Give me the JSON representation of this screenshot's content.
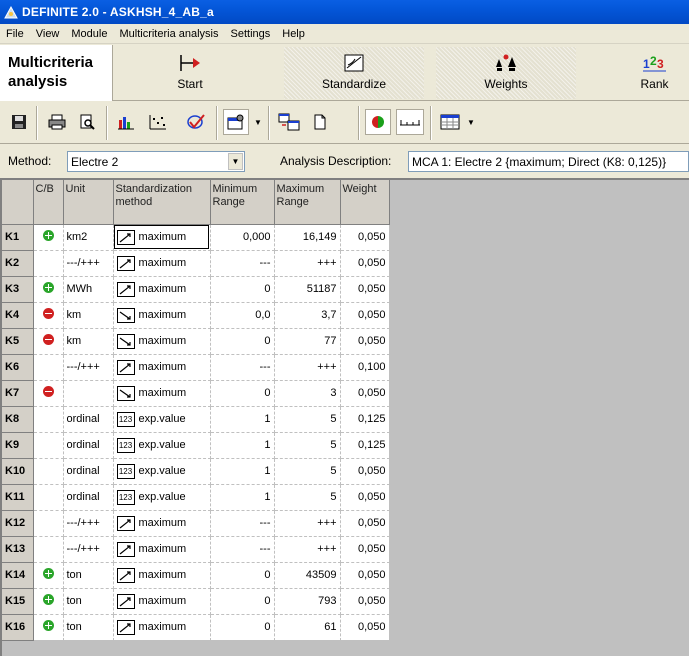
{
  "window": {
    "title": "DEFINITE 2.0 - ASKHSH_4_AB_a"
  },
  "menu": [
    "File",
    "View",
    "Module",
    "Multicriteria analysis",
    "Settings",
    "Help"
  ],
  "panel": {
    "heading_line1": "Multicriteria",
    "heading_line2": "analysis",
    "buttons": {
      "start": "Start",
      "standardize": "Standardize",
      "weights": "Weights",
      "rank": "Rank"
    }
  },
  "method": {
    "label": "Method:",
    "value": "Electre 2",
    "desc_label": "Analysis Description:",
    "desc_value": "MCA 1: Electre 2 {maximum; Direct (K8: 0,125)}"
  },
  "grid": {
    "headers": [
      "",
      "C/B",
      "Unit",
      "Standardization method",
      "Minimum Range",
      "Maximum Range",
      "Weight"
    ],
    "rows": [
      {
        "id": "K1",
        "cb": "+",
        "unit": "km2",
        "icon": "up",
        "method": "maximum",
        "min": "0,000",
        "max": "16,149",
        "weight": "0,050"
      },
      {
        "id": "K2",
        "cb": "",
        "unit": "---/+++",
        "icon": "up",
        "method": "maximum",
        "min": "---",
        "max": "+++",
        "weight": "0,050"
      },
      {
        "id": "K3",
        "cb": "+",
        "unit": "MWh",
        "icon": "up",
        "method": "maximum",
        "min": "0",
        "max": "51187",
        "weight": "0,050"
      },
      {
        "id": "K4",
        "cb": "-",
        "unit": "km",
        "icon": "down",
        "method": "maximum",
        "min": "0,0",
        "max": "3,7",
        "weight": "0,050"
      },
      {
        "id": "K5",
        "cb": "-",
        "unit": "km",
        "icon": "down",
        "method": "maximum",
        "min": "0",
        "max": "77",
        "weight": "0,050"
      },
      {
        "id": "K6",
        "cb": "",
        "unit": "---/+++",
        "icon": "up",
        "method": "maximum",
        "min": "---",
        "max": "+++",
        "weight": "0,100"
      },
      {
        "id": "K7",
        "cb": "-",
        "unit": "",
        "icon": "down",
        "method": "maximum",
        "min": "0",
        "max": "3",
        "weight": "0,050"
      },
      {
        "id": "K8",
        "cb": "",
        "unit": "ordinal",
        "icon": "123",
        "method": "exp.value",
        "min": "1",
        "max": "5",
        "weight": "0,125"
      },
      {
        "id": "K9",
        "cb": "",
        "unit": "ordinal",
        "icon": "123",
        "method": "exp.value",
        "min": "1",
        "max": "5",
        "weight": "0,125"
      },
      {
        "id": "K10",
        "cb": "",
        "unit": "ordinal",
        "icon": "123",
        "method": "exp.value",
        "min": "1",
        "max": "5",
        "weight": "0,050"
      },
      {
        "id": "K11",
        "cb": "",
        "unit": "ordinal",
        "icon": "123",
        "method": "exp.value",
        "min": "1",
        "max": "5",
        "weight": "0,050"
      },
      {
        "id": "K12",
        "cb": "",
        "unit": "---/+++",
        "icon": "up",
        "method": "maximum",
        "min": "---",
        "max": "+++",
        "weight": "0,050"
      },
      {
        "id": "K13",
        "cb": "",
        "unit": "---/+++",
        "icon": "up",
        "method": "maximum",
        "min": "---",
        "max": "+++",
        "weight": "0,050"
      },
      {
        "id": "K14",
        "cb": "+",
        "unit": "ton",
        "icon": "up",
        "method": "maximum",
        "min": "0",
        "max": "43509",
        "weight": "0,050"
      },
      {
        "id": "K15",
        "cb": "+",
        "unit": "ton",
        "icon": "up",
        "method": "maximum",
        "min": "0",
        "max": "793",
        "weight": "0,050"
      },
      {
        "id": "K16",
        "cb": "+",
        "unit": "ton",
        "icon": "up",
        "method": "maximum",
        "min": "0",
        "max": "61",
        "weight": "0,050"
      }
    ]
  }
}
